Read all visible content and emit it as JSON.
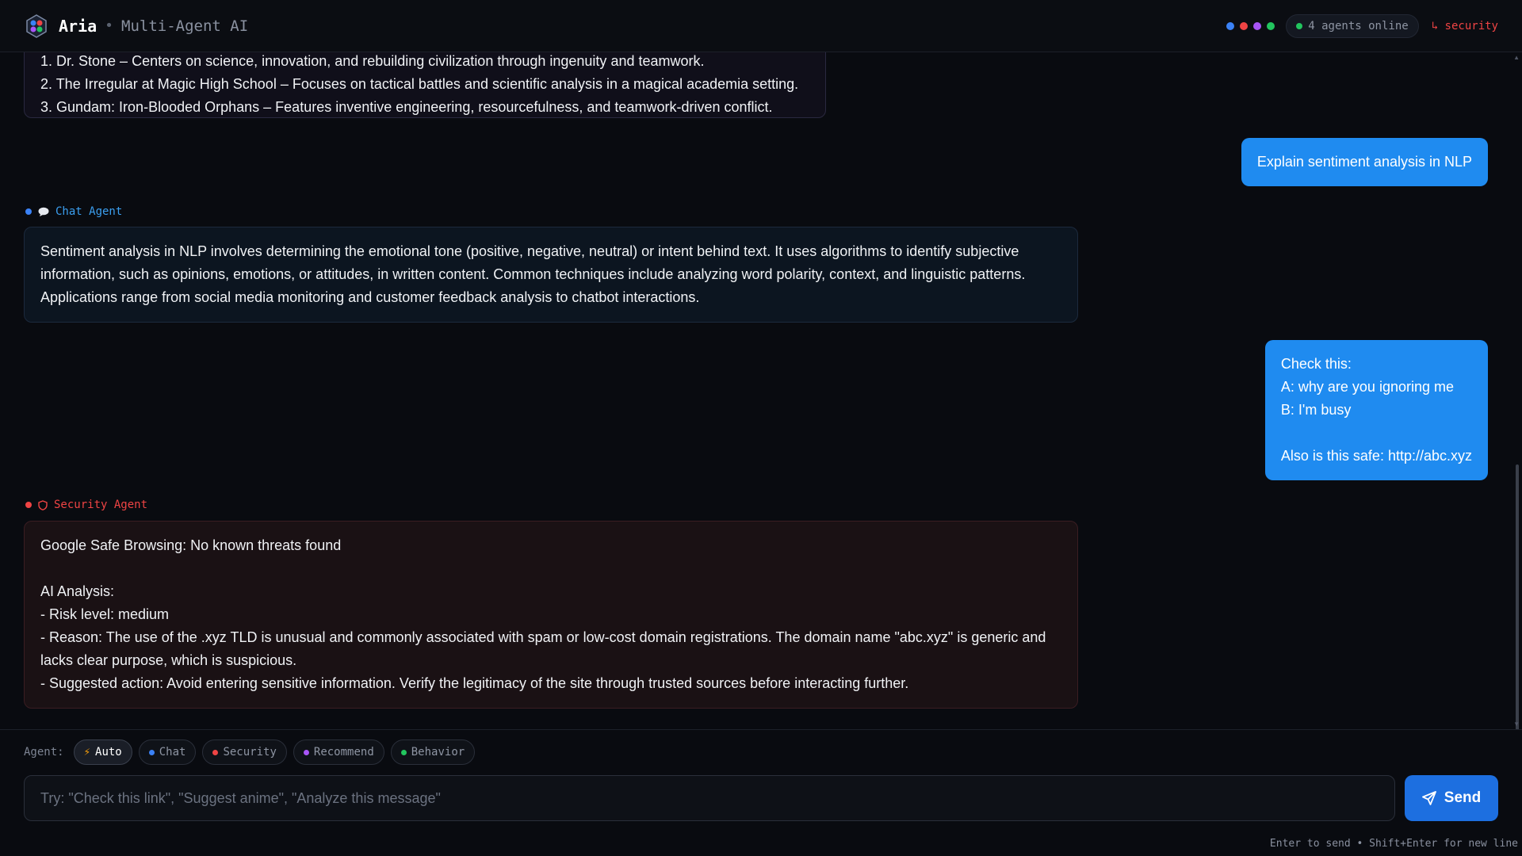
{
  "header": {
    "app_name": "Aria",
    "separator": "•",
    "subtitle": "Multi-Agent AI",
    "status_colors": [
      "#3b82f6",
      "#ef4444",
      "#a855f7",
      "#22c55e"
    ],
    "online_text": "4 agents online",
    "route_text": "↳ security"
  },
  "messages": {
    "bot_top": {
      "lines": [
        "1. Dr. Stone – Centers on science, innovation, and rebuilding civilization through ingenuity and teamwork.",
        "2. The Irregular at Magic High School – Focuses on tactical battles and scientific analysis in a magical academia setting.",
        "3. Gundam: Iron-Blooded Orphans – Features inventive engineering, resourcefulness, and teamwork-driven conflict."
      ]
    },
    "user1": {
      "text": "Explain sentiment analysis in NLP"
    },
    "chat_agent": {
      "label": "Chat Agent",
      "color": "#3b9ff0",
      "icon": "speech-bubble-icon",
      "lines": [
        "Sentiment analysis in NLP involves determining the emotional tone (positive, negative, neutral) or intent behind text. It uses algorithms to identify subjective",
        "information, such as opinions, emotions, or attitudes, in written content. Common techniques include analyzing word polarity, context, and linguistic patterns.",
        "Applications range from social media monitoring and customer feedback analysis to chatbot interactions."
      ]
    },
    "user2": {
      "lines": [
        "Check this:",
        "A: why are you ignoring me",
        "B: I'm busy",
        "",
        "Also is this safe: http://abc.xyz"
      ]
    },
    "security_agent": {
      "label": "Security Agent",
      "color": "#ef4444",
      "icon": "shield-icon",
      "lines": [
        "Google Safe Browsing: No known threats found",
        "",
        "AI Analysis:",
        "- Risk level: medium",
        "- Reason: The use of the .xyz TLD is unusual and commonly associated with spam or low-cost domain registrations. The domain name \"abc.xyz\" is generic and",
        "lacks clear purpose, which is suspicious.",
        "- Suggested action: Avoid entering sensitive information. Verify the legitimacy of the site through trusted sources before interacting further."
      ]
    }
  },
  "composer": {
    "agent_label": "Agent:",
    "chips": [
      {
        "label": "Auto",
        "icon": "bolt-icon",
        "active": true
      },
      {
        "label": "Chat",
        "color": "#3b82f6"
      },
      {
        "label": "Security",
        "color": "#ef4444"
      },
      {
        "label": "Recommend",
        "color": "#a855f7"
      },
      {
        "label": "Behavior",
        "color": "#22c55e"
      }
    ],
    "placeholder": "Try: \"Check this link\", \"Suggest anime\", \"Analyze this message\"",
    "send_label": "Send",
    "hint": "Enter to send • Shift+Enter for new line"
  }
}
